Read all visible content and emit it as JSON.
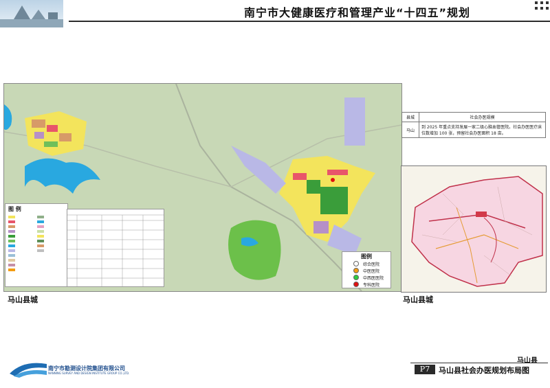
{
  "header": {
    "title": "南宁市大健康医疗和管理产业“十四五”规划"
  },
  "map": {
    "legend_title": "图  例",
    "poi_legend": {
      "title": "图例",
      "items": [
        {
          "label": "综合医院",
          "color": "#ffffff"
        },
        {
          "label": "中医医院",
          "color": "#f39c12"
        },
        {
          "label": "中西医医院",
          "color": "#2ecc40"
        },
        {
          "label": "专科医院",
          "color": "#e01010"
        }
      ]
    },
    "caption_left": "马山县城"
  },
  "info_table": {
    "header": [
      "县城",
      "社会办医规模"
    ],
    "county": "马山",
    "content": "到 2025 年重点支持发展一家二级心脑血管医院。社会办医医疗床位数增加 100 张，预留社会办医面积 18 亩。"
  },
  "inset": {
    "caption": "马山县城"
  },
  "footer": {
    "company": "南宁市勘测设计院集团有限公司",
    "company_en": "NANNING SURVEY AND DESIGN INSTITUTE GROUP CO.,LTD.",
    "region": "马山县",
    "page_no": "P7",
    "page_title": "马山县社会办医规划布局图"
  },
  "colors": {
    "terrain": "#c7d7b8",
    "residential": "#f5e35a",
    "commercial": "#e8556a",
    "green": "#3a9d3a",
    "water": "#2aa9e0",
    "accent": "#1e4d8c"
  }
}
